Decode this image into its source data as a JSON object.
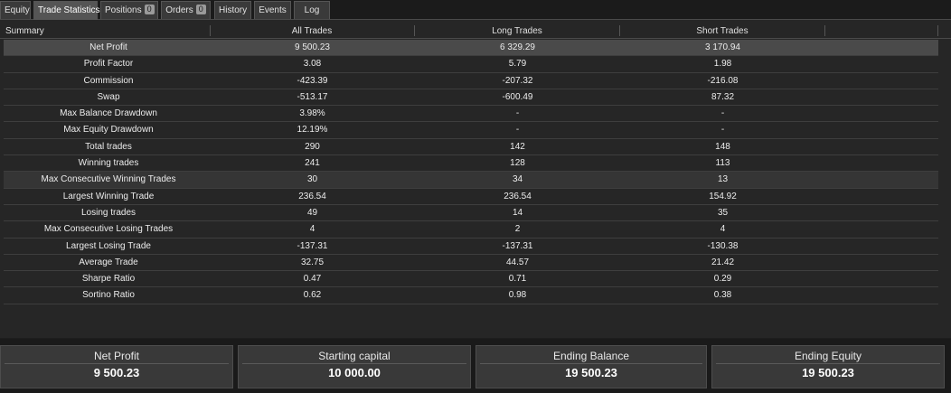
{
  "tabs": [
    {
      "label": "Equity"
    },
    {
      "label": "Trade Statistics",
      "active": true
    },
    {
      "label": "Positions",
      "badge": "0"
    },
    {
      "label": "Orders",
      "badge": "0"
    },
    {
      "label": "History"
    },
    {
      "label": "Events"
    },
    {
      "label": "Log"
    }
  ],
  "table": {
    "headers": [
      "Summary",
      "All Trades",
      "Long Trades",
      "Short Trades"
    ],
    "rows": [
      [
        "Net Profit",
        "9 500.23",
        "6 329.29",
        "3 170.94"
      ],
      [
        "Profit Factor",
        "3.08",
        "5.79",
        "1.98"
      ],
      [
        "Commission",
        "-423.39",
        "-207.32",
        "-216.08"
      ],
      [
        "Swap",
        "-513.17",
        "-600.49",
        "87.32"
      ],
      [
        "Max Balance Drawdown",
        "3.98%",
        "-",
        "-"
      ],
      [
        "Max Equity Drawdown",
        "12.19%",
        "-",
        "-"
      ],
      [
        "Total trades",
        "290",
        "142",
        "148"
      ],
      [
        "Winning trades",
        "241",
        "128",
        "113"
      ],
      [
        "Max Consecutive Winning Trades",
        "30",
        "34",
        "13"
      ],
      [
        "Largest Winning Trade",
        "236.54",
        "236.54",
        "154.92"
      ],
      [
        "Losing trades",
        "49",
        "14",
        "35"
      ],
      [
        "Max Consecutive Losing Trades",
        "4",
        "2",
        "4"
      ],
      [
        "Largest Losing Trade",
        "-137.31",
        "-137.31",
        "-130.38"
      ],
      [
        "Average Trade",
        "32.75",
        "44.57",
        "21.42"
      ],
      [
        "Sharpe Ratio",
        "0.47",
        "0.71",
        "0.29"
      ],
      [
        "Sortino Ratio",
        "0.62",
        "0.98",
        "0.38"
      ]
    ]
  },
  "summary_cards": [
    {
      "label": "Net Profit",
      "value": "9 500.23"
    },
    {
      "label": "Starting capital",
      "value": "10 000.00"
    },
    {
      "label": "Ending Balance",
      "value": "19 500.23"
    },
    {
      "label": "Ending Equity",
      "value": "19 500.23"
    }
  ]
}
